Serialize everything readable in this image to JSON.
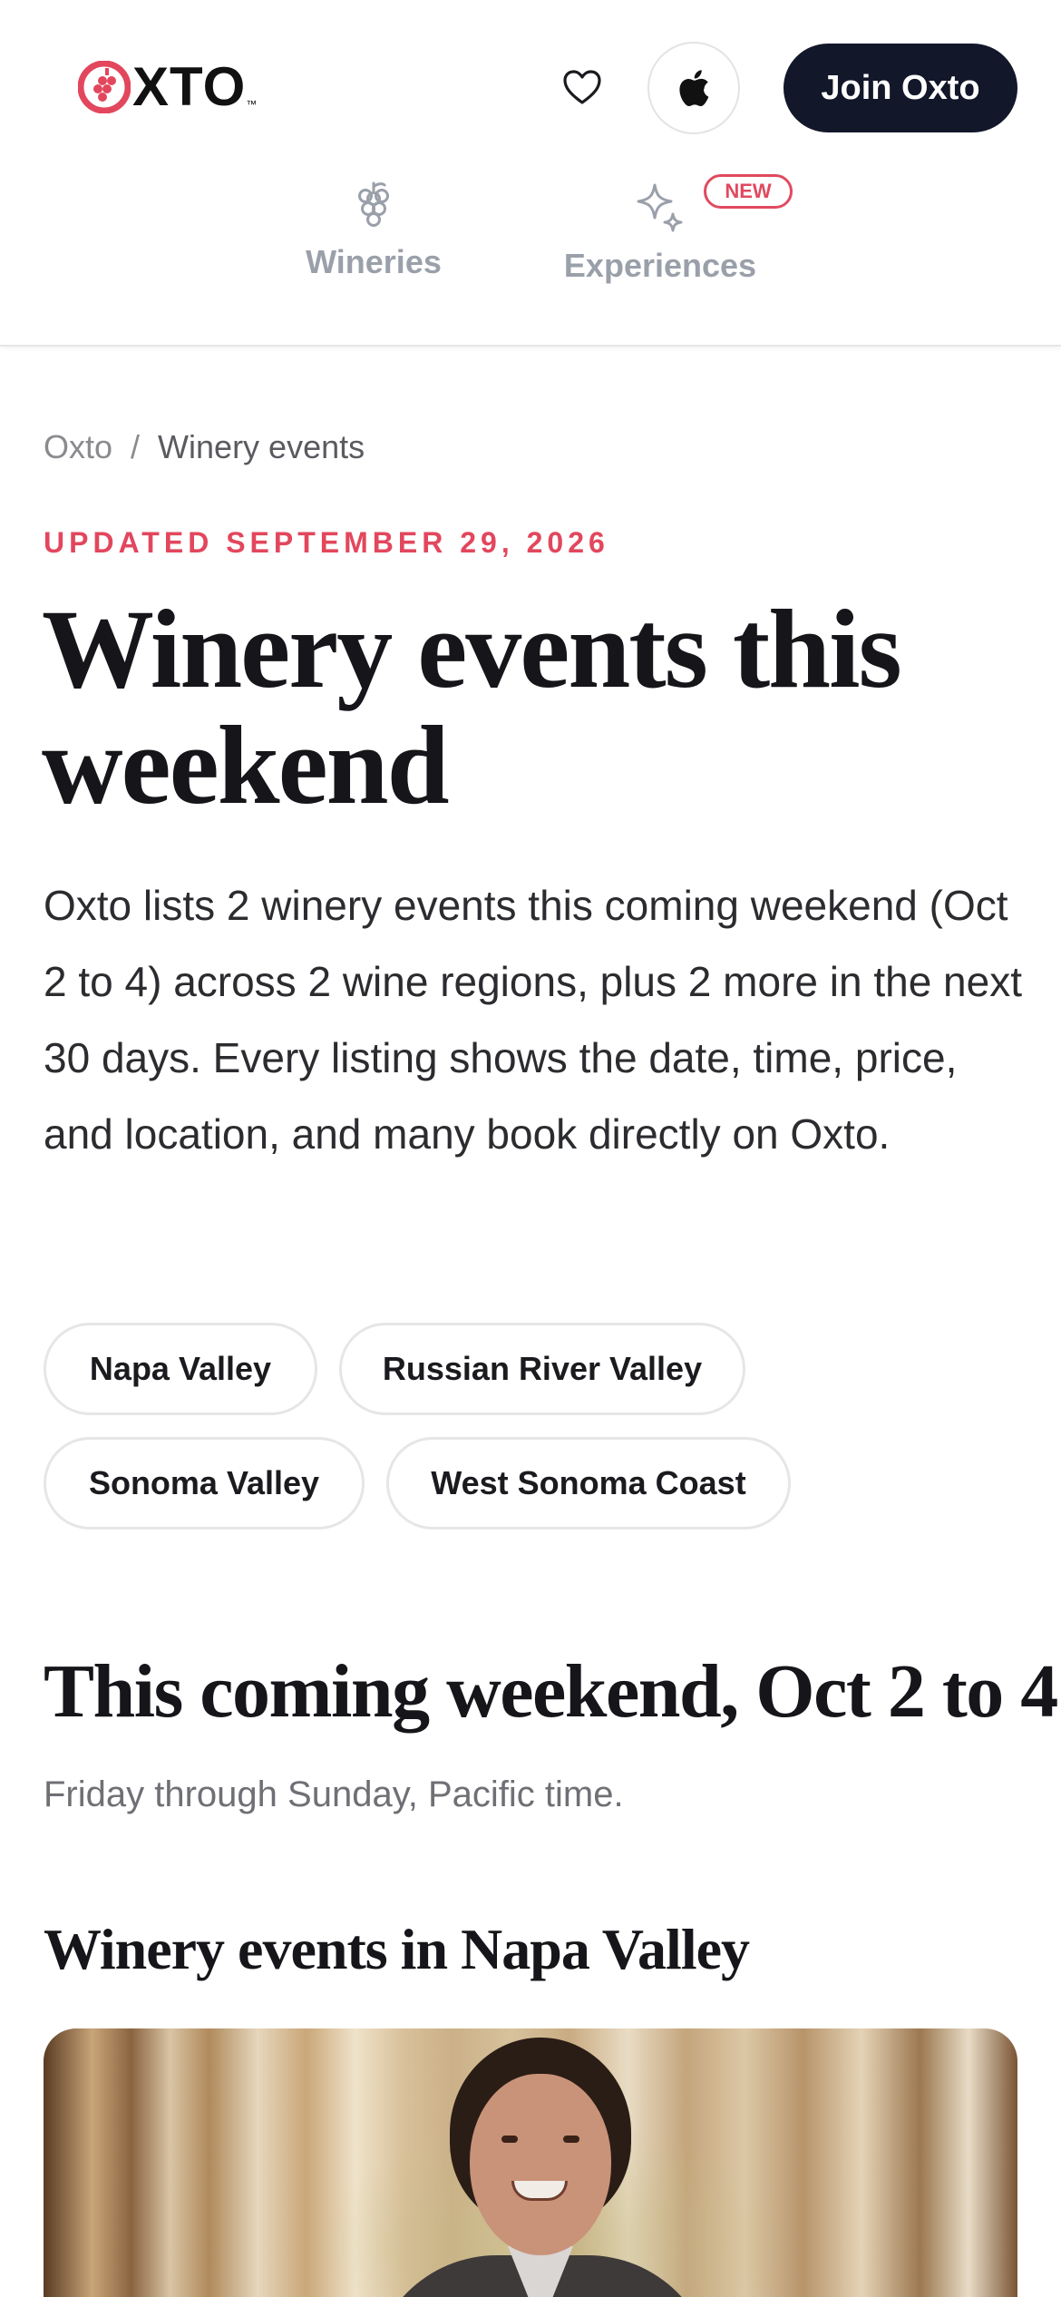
{
  "header": {
    "logo_text": "XTO",
    "logo_tm": "™",
    "join_label": "Join Oxto",
    "icons": {
      "favorites": "heart-icon",
      "apple": "apple-icon"
    },
    "nav": [
      {
        "label": "Wineries",
        "icon": "grapes-icon"
      },
      {
        "label": "Experiences",
        "icon": "sparkle-icon",
        "badge": "NEW"
      }
    ],
    "colors": {
      "brand_red": "#e2475d",
      "join_bg": "#12172a"
    }
  },
  "breadcrumb": {
    "root": "Oxto",
    "separator": "/",
    "current": "Winery events"
  },
  "updated_label": "UPDATED SEPTEMBER 29, 2026",
  "title": "Winery events this weekend",
  "intro": "Oxto lists 2 winery events this coming weekend (Oct 2 to 4) across 2 wine regions, plus 2 more in the next 30 days. Every listing shows the date, time, price, and location, and many book directly on Oxto.",
  "region_chips": [
    "Napa Valley",
    "Russian River Valley",
    "Sonoma Valley",
    "West Sonoma Coast"
  ],
  "weekend": {
    "title": "This coming weekend, Oct 2 to 4",
    "subtitle": "Friday through Sunday, Pacific time."
  },
  "section": {
    "title": "Winery events in Napa Valley"
  }
}
